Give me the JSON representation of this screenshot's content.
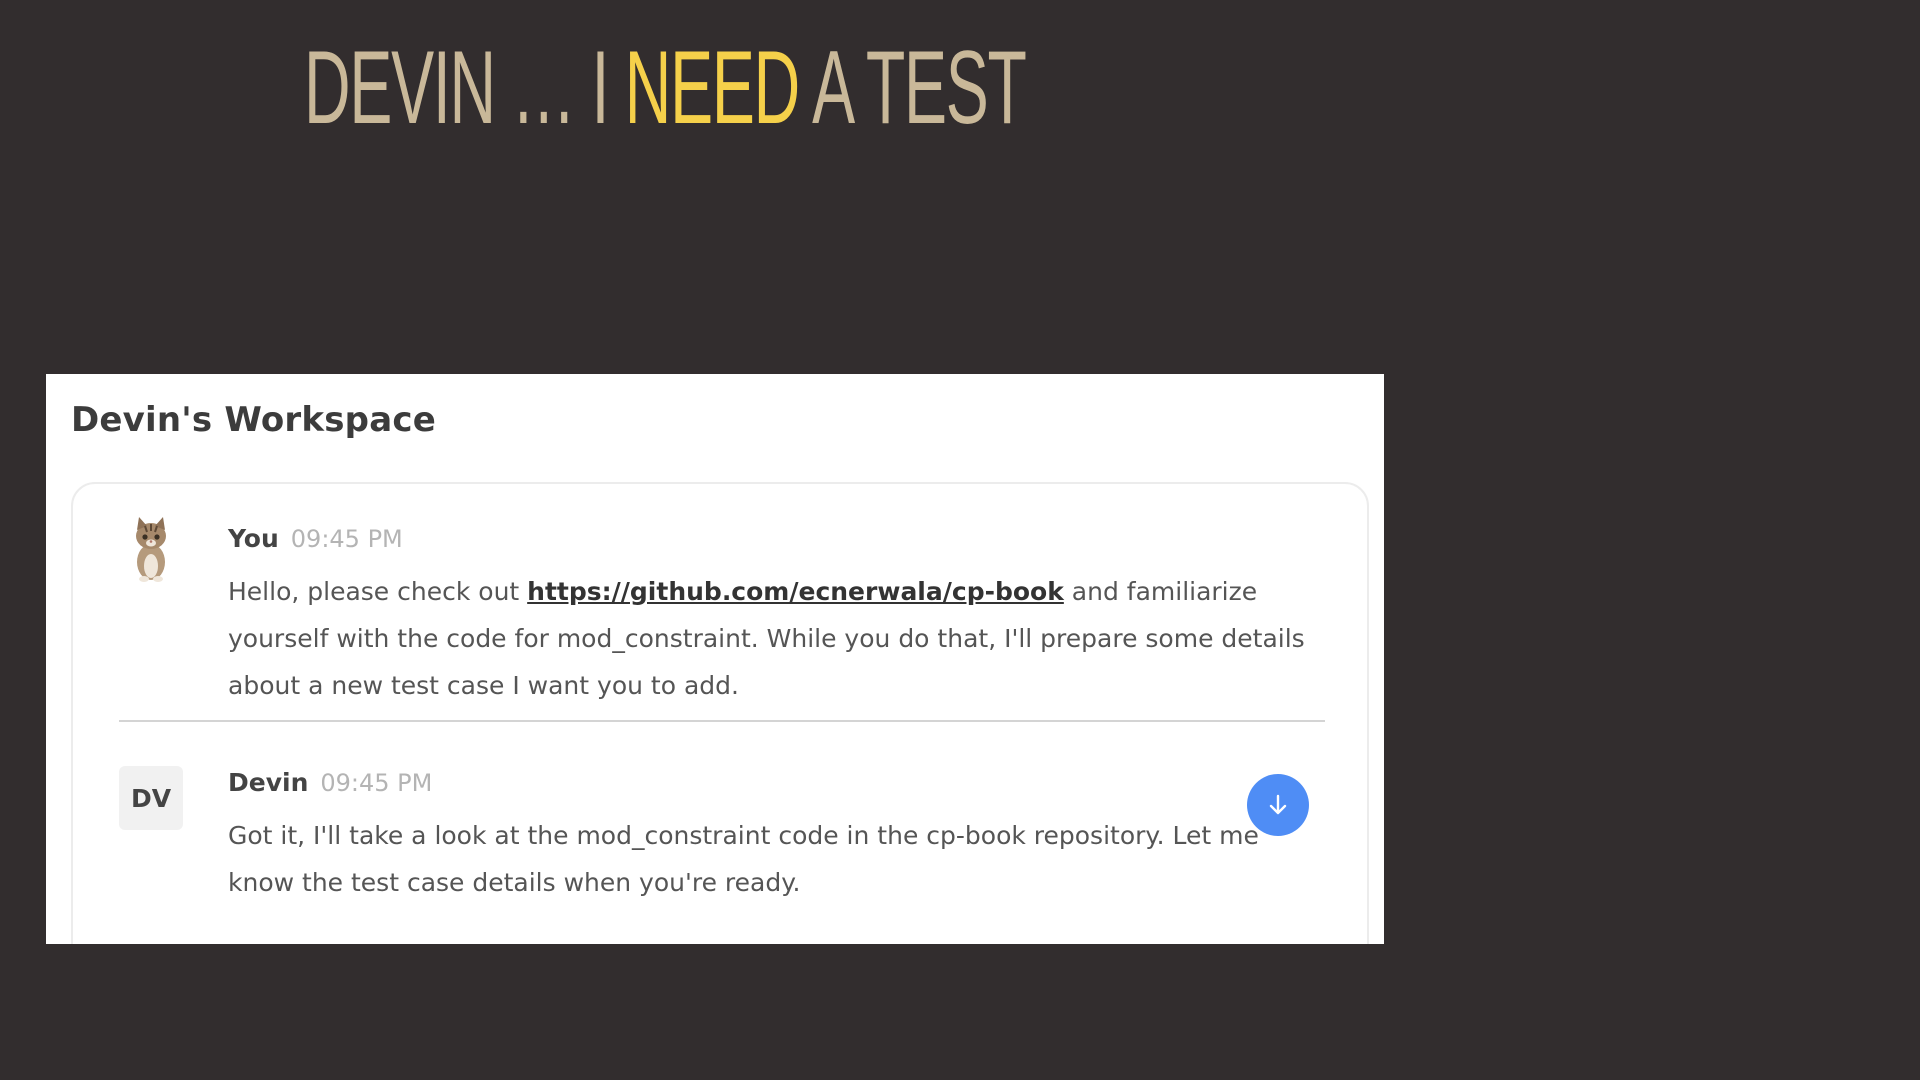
{
  "slide": {
    "title_before": "DEVIN … I ",
    "title_accent": "NEED",
    "title_after": " A TEST"
  },
  "workspace": {
    "title": "Devin's Workspace",
    "messages": [
      {
        "sender": "You",
        "time": "09:45 PM",
        "avatar": "cat-avatar-icon",
        "text_before": "Hello, please check out ",
        "link": "https://github.com/ecnerwala/cp-book",
        "text_after": " and familiarize yourself with the code for mod_constraint. While you do that, I'll prepare some details about a new test case I want you to add."
      },
      {
        "sender": "Devin",
        "time": "09:45 PM",
        "avatar_initials": "DV",
        "text": "Got it, I'll take a look at the mod_constraint code in the cp-book repository. Let me know the test case details when you're ready."
      }
    ],
    "scroll_button_icon": "arrow-down-icon"
  },
  "colors": {
    "background": "#322d2e",
    "title": "#c9b899",
    "title_accent": "#f5d04a",
    "scroll_button": "#4f8df5"
  }
}
